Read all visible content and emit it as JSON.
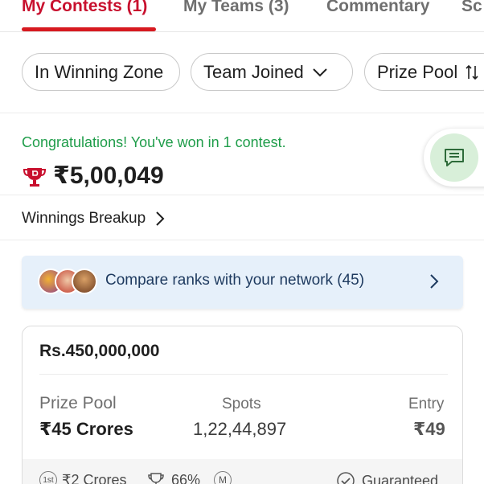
{
  "tabs": [
    {
      "label": "My Contests (1)",
      "active": true
    },
    {
      "label": "My Teams (3)",
      "active": false
    },
    {
      "label": "Commentary",
      "active": false
    },
    {
      "label": "Sc",
      "active": false
    }
  ],
  "filters": {
    "in_winning_zone": "In Winning Zone",
    "team_joined": "Team Joined",
    "prize_pool": "Prize Pool"
  },
  "winnings": {
    "congrats": "Congratulations! You've won in 1 contest.",
    "amount": "₹5,00,049",
    "breakup_label": "Winnings Breakup"
  },
  "compare": {
    "text": "Compare ranks with your network (45)"
  },
  "contest": {
    "title": "Rs.450,000,000",
    "prize_pool_label": "Prize Pool",
    "prize_pool_value": "₹45 Crores",
    "spots_label": "Spots",
    "spots_value": "1,22,44,897",
    "entry_label": "Entry",
    "entry_value": "₹49",
    "first_prize_badge": "1st",
    "first_prize": "₹2 Crores",
    "win_percent": "66%",
    "multi_badge": "M",
    "guaranteed": "Guaranteed"
  },
  "colors": {
    "accent_red": "#d71920",
    "success_green": "#1f9d4a",
    "banner_blue": "#e6f0fa"
  },
  "icons": [
    "chevron-down-icon",
    "sort-icon",
    "trophy-icon",
    "chat-icon",
    "chevron-right-icon",
    "trophy-outline-icon",
    "check-circle-icon"
  ]
}
